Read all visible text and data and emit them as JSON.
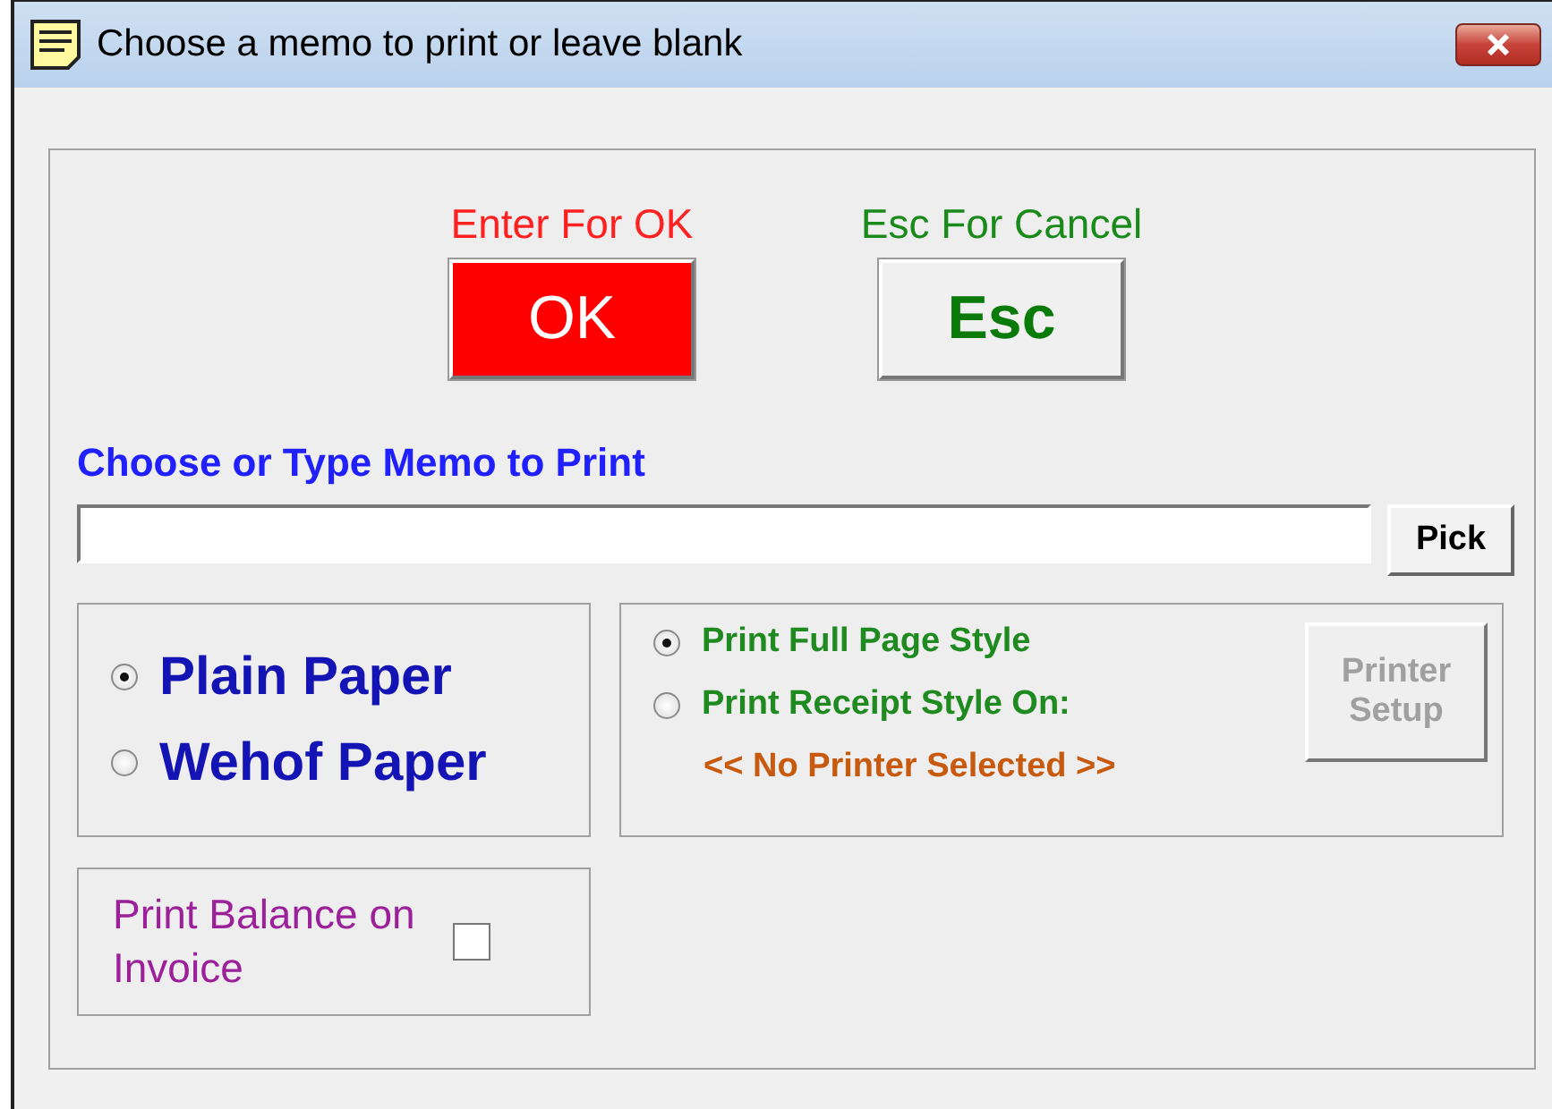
{
  "window": {
    "title": "Choose a memo to print or leave blank"
  },
  "actions": [
    {
      "kind": "ok",
      "caption": "Enter For OK",
      "label": "OK"
    },
    {
      "kind": "cancel",
      "caption": "Esc For Cancel",
      "label": "Esc"
    }
  ],
  "memo": {
    "label": "Choose or Type Memo to Print",
    "pick_button": "Pick"
  },
  "paper": [
    {
      "label": "Plain Paper",
      "selected": true
    },
    {
      "label": "Wehof Paper",
      "selected": false
    }
  ],
  "print_style": [
    {
      "label": "Print Full Page Style",
      "selected": true
    },
    {
      "label": "Print Receipt Style On:",
      "selected": false
    }
  ],
  "printer_name": "<< No Printer Selected >>",
  "printer_setup": {
    "label": "Printer Setup",
    "disabled": true
  },
  "print_balance": {
    "label": "Print Balance on Invoice",
    "checked": false
  }
}
